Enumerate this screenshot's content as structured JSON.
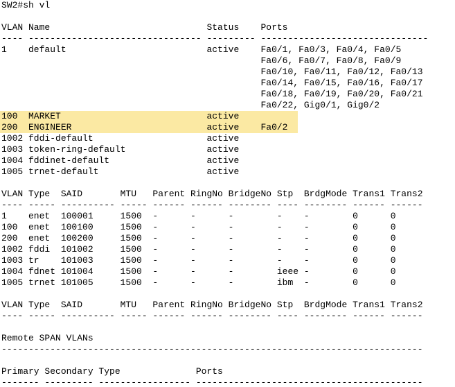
{
  "colors": {
    "background": "#ffffff",
    "text": "#000000",
    "highlight": "#fbe9a3"
  },
  "terminal": {
    "lines": [
      {
        "text": "SW2#sh vl"
      },
      {
        "text": ""
      },
      {
        "text": "VLAN Name                             Status    Ports"
      },
      {
        "text": "---- -------------------------------- --------- -------------------------------"
      },
      {
        "text": "1    default                          active    Fa0/1, Fa0/3, Fa0/4, Fa0/5"
      },
      {
        "text": "                                                Fa0/6, Fa0/7, Fa0/8, Fa0/9"
      },
      {
        "text": "                                                Fa0/10, Fa0/11, Fa0/12, Fa0/13"
      },
      {
        "text": "                                                Fa0/14, Fa0/15, Fa0/16, Fa0/17"
      },
      {
        "text": "                                                Fa0/18, Fa0/19, Fa0/20, Fa0/21"
      },
      {
        "text": "                                                Fa0/22, Gig0/1, Gig0/2"
      },
      {
        "text": "100  MARKET                           active",
        "highlight": true
      },
      {
        "text": "200  ENGINEER                         active    Fa0/2",
        "highlight": true
      },
      {
        "text": "1002 fddi-default                     active"
      },
      {
        "text": "1003 token-ring-default               active"
      },
      {
        "text": "1004 fddinet-default                  active"
      },
      {
        "text": "1005 trnet-default                    active"
      },
      {
        "text": ""
      },
      {
        "text": "VLAN Type  SAID       MTU   Parent RingNo BridgeNo Stp  BrdgMode Trans1 Trans2"
      },
      {
        "text": "---- ----- ---------- ----- ------ ------ -------- ---- -------- ------ ------"
      },
      {
        "text": "1    enet  100001     1500  -      -      -        -    -        0      0"
      },
      {
        "text": "100  enet  100100     1500  -      -      -        -    -        0      0"
      },
      {
        "text": "200  enet  100200     1500  -      -      -        -    -        0      0"
      },
      {
        "text": "1002 fddi  101002     1500  -      -      -        -    -        0      0"
      },
      {
        "text": "1003 tr    101003     1500  -      -      -        -    -        0      0"
      },
      {
        "text": "1004 fdnet 101004     1500  -      -      -        ieee -        0      0"
      },
      {
        "text": "1005 trnet 101005     1500  -      -      -        ibm  -        0      0"
      },
      {
        "text": ""
      },
      {
        "text": "VLAN Type  SAID       MTU   Parent RingNo BridgeNo Stp  BrdgMode Trans1 Trans2"
      },
      {
        "text": "---- ----- ---------- ----- ------ ------ -------- ---- -------- ------ ------"
      },
      {
        "text": ""
      },
      {
        "text": "Remote SPAN VLANs"
      },
      {
        "text": "------------------------------------------------------------------------------"
      },
      {
        "text": ""
      },
      {
        "text": "Primary Secondary Type              Ports"
      },
      {
        "text": "------- --------- ----------------- ------------------------------------------"
      }
    ]
  }
}
